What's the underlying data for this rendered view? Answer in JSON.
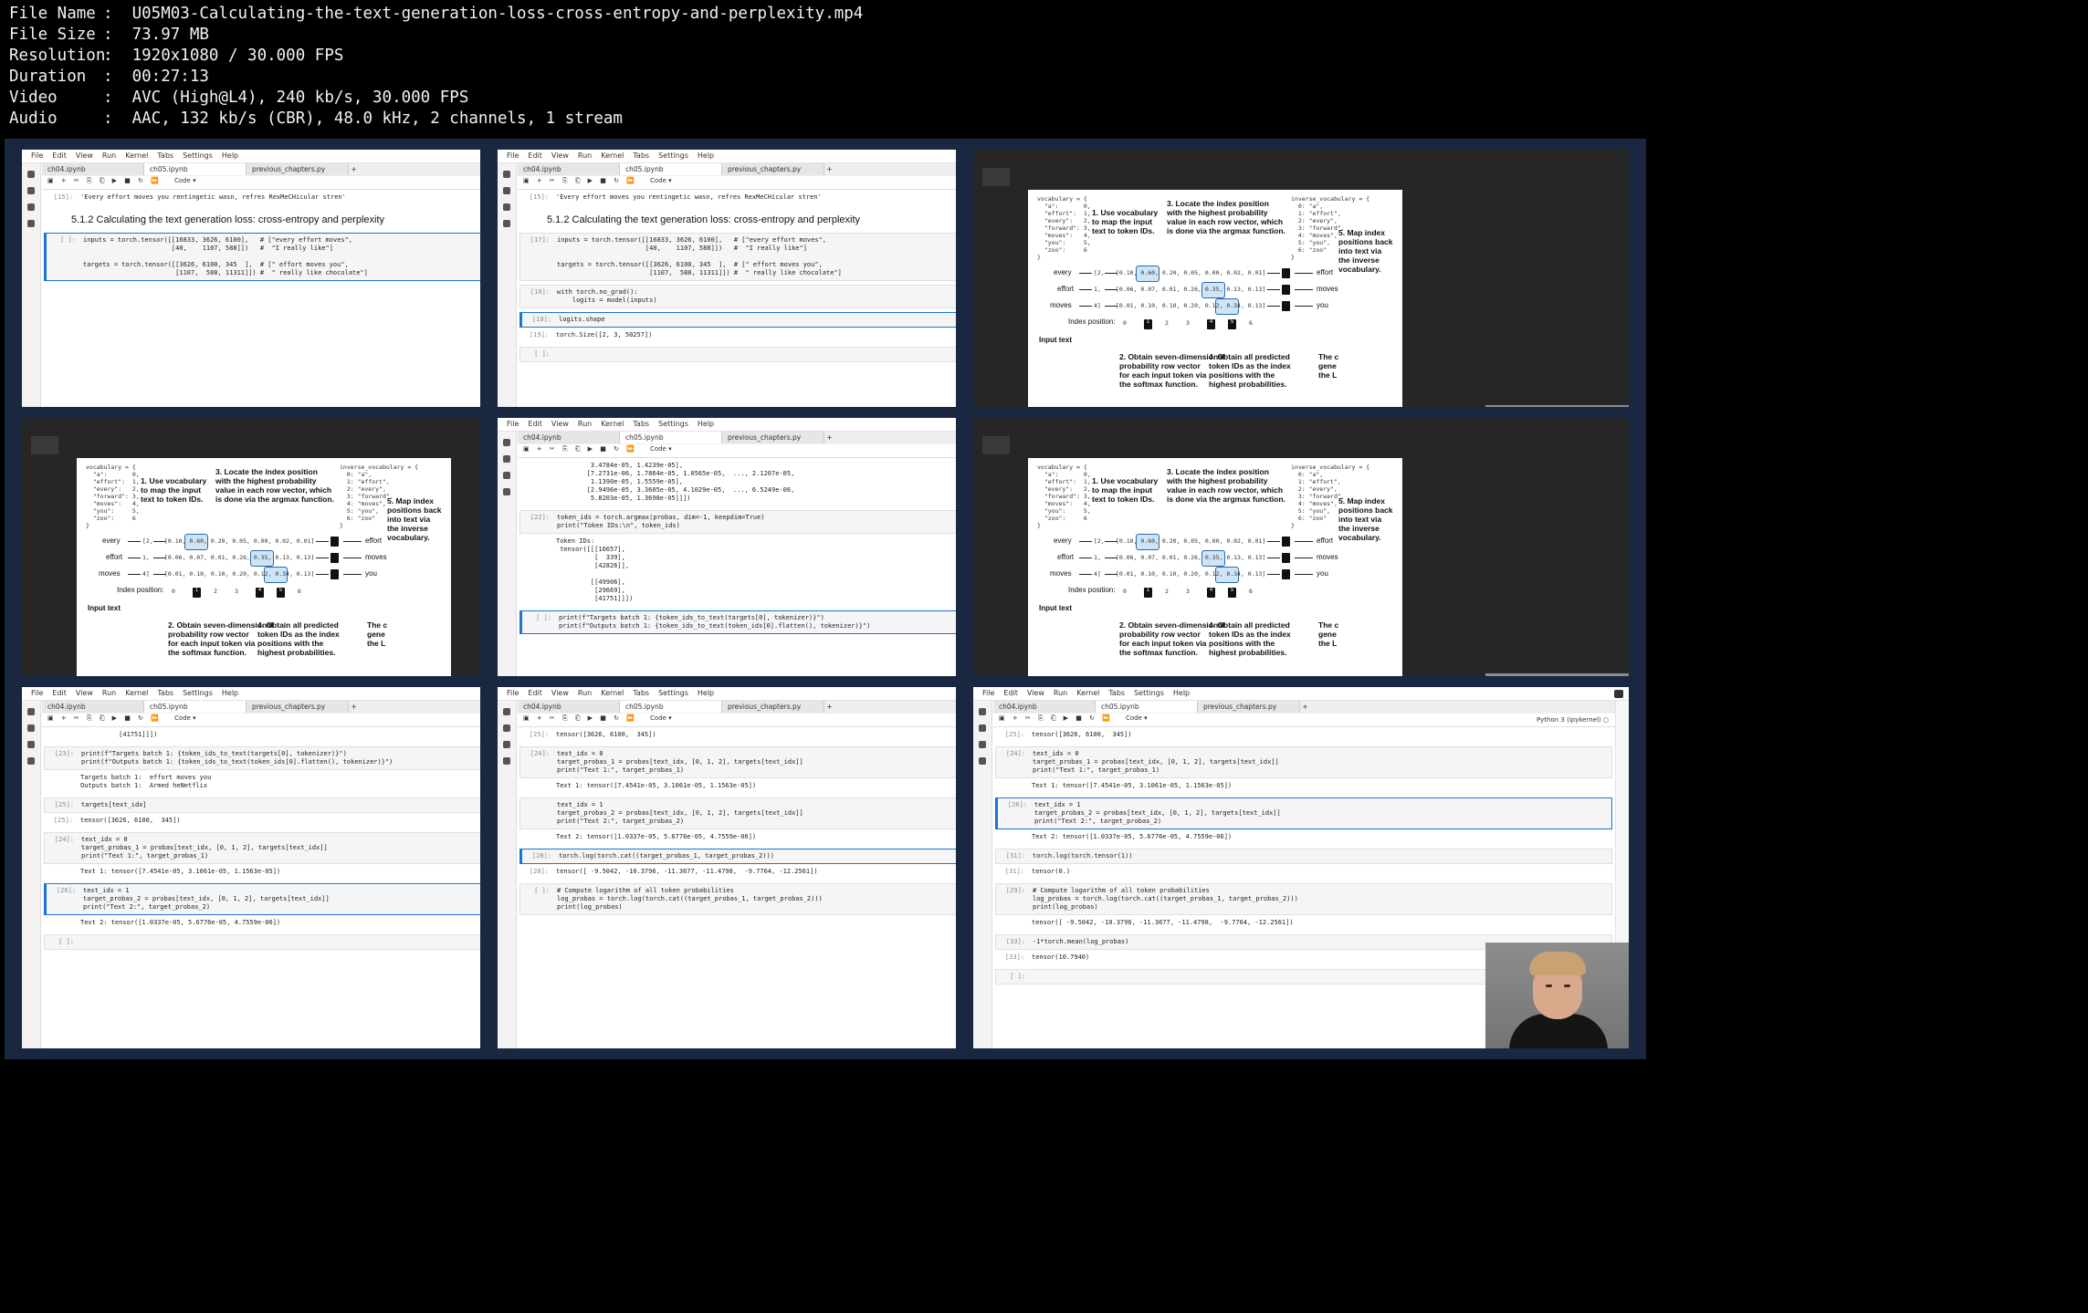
{
  "file_info": [
    {
      "key": "File Name",
      "value": "U05M03-Calculating-the-text-generation-loss-cross-entropy-and-perplexity.mp4"
    },
    {
      "key": "File Size",
      "value": "73.97 MB"
    },
    {
      "key": "Resolution",
      "value": "1920x1080 / 30.000 FPS"
    },
    {
      "key": "Duration",
      "value": "00:27:13"
    },
    {
      "key": "Video",
      "value": "AVC (High@L4), 240 kb/s, 30.000 FPS"
    },
    {
      "key": "Audio",
      "value": "AAC, 132 kb/s (CBR), 48.0 kHz, 2 channels, 1 stream"
    }
  ],
  "ui": {
    "menu": [
      "File",
      "Edit",
      "View",
      "Run",
      "Kernel",
      "Tabs",
      "Settings",
      "Help"
    ],
    "tabs": [
      "ch04.ipynb",
      "ch05.ipynb",
      "previous_chapters.py"
    ],
    "cell_type": "Code",
    "kernel": "Python 3 (ipykernel)"
  },
  "tiles": [
    {
      "type": "notebook",
      "heading": "5.1.2 Calculating the text generation loss: cross-entropy and perplexity",
      "cells": [
        {
          "prompt": "[15]:",
          "kind": "out",
          "lines": [
            "'Every effort moves you rentingetic wasn, refres RexMeCHicular stren'"
          ]
        },
        {
          "prompt": "[ ]:",
          "kind": "code",
          "active": true,
          "lines": [
            "inputs = torch.tensor([[16833, 3626, 6100],   # [\"every effort moves\",",
            "                       [40,    1107, 588]])   #  \"I really like\"]",
            "",
            "targets = torch.tensor([[3626, 6100, 345  ],  # [\" effort moves you\",",
            "                        [1107,  588, 11311]]) #  \" really like chocolate\"]"
          ]
        }
      ]
    },
    {
      "type": "notebook",
      "heading": "5.1.2 Calculating the text generation loss: cross-entropy and perplexity",
      "cells": [
        {
          "prompt": "[15]:",
          "kind": "out",
          "lines": [
            "'Every effort moves you rentingetic wasn, refres RexMeCHicular stren'"
          ]
        },
        {
          "prompt": "[17]:",
          "kind": "code",
          "lines": [
            "inputs = torch.tensor([[16833, 3626, 6100],   # [\"every effort moves\",",
            "                       [40,    1107, 588]])   #  \"I really like\"]",
            "",
            "targets = torch.tensor([[3626, 6100, 345  ],  # [\" effort moves you\",",
            "                        [1107,  588, 11311]]) #  \" really like chocolate\"]"
          ]
        },
        {
          "prompt": "[18]:",
          "kind": "code",
          "lines": [
            "with torch.no_grad():",
            "    logits = model(inputs)"
          ]
        },
        {
          "prompt": "[19]:",
          "kind": "code",
          "active": true,
          "lines": [
            "logits.shape"
          ]
        },
        {
          "prompt": "[19]:",
          "kind": "out",
          "lines": [
            "torch.Size([2, 3, 50257])"
          ]
        },
        {
          "prompt": "[ ]:",
          "kind": "code",
          "lines": [
            ""
          ]
        }
      ]
    },
    {
      "type": "diagram"
    },
    {
      "type": "diagram"
    },
    {
      "type": "notebook",
      "cells": [
        {
          "prompt": "",
          "kind": "out",
          "lines": [
            "         3.4784e-05, 1.4239e-05],",
            "        [7.2731e-06, 1.7864e-05, 1.0565e-05,  ..., 2.1207e-05,",
            "         1.1390e-05, 1.5559e-05],",
            "        [2.9496e-05, 3.3605e-05, 4.1029e-05,  ..., 6.5249e-06,",
            "         5.8203e-05, 1.3698e-05]]])"
          ]
        },
        {
          "prompt": "[22]:",
          "kind": "code",
          "lines": [
            "token_ids = torch.argmax(probas, dim=-1, keepdim=True)",
            "print(\"Token IDs:\\n\", token_ids)"
          ]
        },
        {
          "prompt": "",
          "kind": "out",
          "lines": [
            "Token IDs:",
            " tensor([[[16657],",
            "          [  339],",
            "          [42826]],",
            "",
            "         [[49906],",
            "          [29669],",
            "          [41751]]])"
          ]
        },
        {
          "prompt": "[ ]:",
          "kind": "code",
          "active": true,
          "lines": [
            "print(f\"Targets batch 1: {token_ids_to_text(targets[0], tokenizer)}\")",
            "print(f\"Outputs batch 1: {token_ids_to_text(token_ids[0].flatten(), tokenizer)}\")"
          ]
        }
      ]
    },
    {
      "type": "diagram"
    },
    {
      "type": "notebook",
      "cells": [
        {
          "prompt": "",
          "kind": "out",
          "lines": [
            "          [41751]]])"
          ]
        },
        {
          "prompt": "[23]:",
          "kind": "code",
          "lines": [
            "print(f\"Targets batch 1: {token_ids_to_text(targets[0], tokenizer)}\")",
            "print(f\"Outputs batch 1: {token_ids_to_text(token_ids[0].flatten(), tokenizer)}\")"
          ]
        },
        {
          "prompt": "",
          "kind": "out",
          "lines": [
            "Targets batch 1:  effort moves you",
            "Outputs batch 1:  Armed heNetflix"
          ]
        },
        {
          "prompt": "[25]:",
          "kind": "code",
          "lines": [
            "targets[text_idx]"
          ]
        },
        {
          "prompt": "[25]:",
          "kind": "out",
          "lines": [
            "tensor([3626, 6100,  345])"
          ]
        },
        {
          "prompt": "[24]:",
          "kind": "code",
          "lines": [
            "text_idx = 0",
            "target_probas_1 = probas[text_idx, [0, 1, 2], targets[text_idx]]",
            "print(\"Text 1:\", target_probas_1)"
          ]
        },
        {
          "prompt": "",
          "kind": "out",
          "lines": [
            "Text 1: tensor([7.4541e-05, 3.1061e-05, 1.1563e-05])"
          ]
        },
        {
          "prompt": "[26]:",
          "kind": "code",
          "active": true,
          "lines": [
            "text_idx = 1",
            "target_probas_2 = probas[text_idx, [0, 1, 2], targets[text_idx]]",
            "print(\"Text 2:\", target_probas_2)"
          ]
        },
        {
          "prompt": "",
          "kind": "out",
          "lines": [
            "Text 2: tensor([1.0337e-05, 5.6776e-05, 4.7559e-06])"
          ]
        },
        {
          "prompt": "[ ]:",
          "kind": "code",
          "lines": [
            ""
          ]
        }
      ]
    },
    {
      "type": "notebook",
      "cells": [
        {
          "prompt": "[25]:",
          "kind": "out",
          "lines": [
            "tensor([3626, 6100,  345])"
          ]
        },
        {
          "prompt": "[24]:",
          "kind": "code",
          "lines": [
            "text_idx = 0",
            "target_probas_1 = probas[text_idx, [0, 1, 2], targets[text_idx]]",
            "print(\"Text 1:\", target_probas_1)"
          ]
        },
        {
          "prompt": "",
          "kind": "out",
          "lines": [
            "Text 1: tensor([7.4541e-05, 3.1061e-05, 1.1563e-05])"
          ]
        },
        {
          "prompt": "",
          "kind": "code",
          "lines": [
            "text_idx = 1",
            "target_probas_2 = probas[text_idx, [0, 1, 2], targets[text_idx]]",
            "print(\"Text 2:\", target_probas_2)"
          ]
        },
        {
          "prompt": "",
          "kind": "out",
          "lines": [
            "Text 2: tensor([1.0337e-05, 5.6776e-05, 4.7559e-06])"
          ]
        },
        {
          "prompt": "[28]:",
          "kind": "code",
          "active": true,
          "lines": [
            "torch.log(torch.cat((target_probas_1, target_probas_2)))"
          ]
        },
        {
          "prompt": "[28]:",
          "kind": "out",
          "lines": [
            "tensor([ -9.5042, -10.3796, -11.3677, -11.4798,  -9.7764, -12.2561])"
          ]
        },
        {
          "prompt": "[ ]:",
          "kind": "code",
          "lines": [
            "# Compute logarithm of all token probabilities",
            "log_probas = torch.log(torch.cat((target_probas_1, target_probas_2)))",
            "print(log_probas)"
          ]
        }
      ]
    },
    {
      "type": "notebook",
      "cells": [
        {
          "prompt": "[25]:",
          "kind": "out",
          "lines": [
            "tensor([3626, 6100,  345])"
          ]
        },
        {
          "prompt": "[24]:",
          "kind": "code",
          "lines": [
            "text_idx = 0",
            "target_probas_1 = probas[text_idx, [0, 1, 2], targets[text_idx]]",
            "print(\"Text 1:\", target_probas_1)"
          ]
        },
        {
          "prompt": "",
          "kind": "out",
          "lines": [
            "Text 1: tensor([7.4541e-05, 3.1061e-05, 1.1563e-05])"
          ]
        },
        {
          "prompt": "[26]:",
          "kind": "code",
          "active": true,
          "lines": [
            "text_idx = 1",
            "target_probas_2 = probas[text_idx, [0, 1, 2], targets[text_idx]]",
            "print(\"Text 2:\", target_probas_2)"
          ]
        },
        {
          "prompt": "",
          "kind": "out",
          "lines": [
            "Text 2: tensor([1.0337e-05, 5.6776e-05, 4.7559e-06])"
          ]
        },
        {
          "prompt": "[31]:",
          "kind": "code",
          "lines": [
            "torch.log(torch.tensor(1))"
          ]
        },
        {
          "prompt": "[31]:",
          "kind": "out",
          "lines": [
            "tensor(0.)"
          ]
        },
        {
          "prompt": "[29]:",
          "kind": "code",
          "lines": [
            "# Compute logarithm of all token probabilities",
            "log_probas = torch.log(torch.cat((target_probas_1, target_probas_2)))",
            "print(log_probas)"
          ]
        },
        {
          "prompt": "",
          "kind": "out",
          "lines": [
            "tensor([ -9.5042, -10.3796, -11.3677, -11.4798,  -9.7764, -12.2561])"
          ]
        },
        {
          "prompt": "[33]:",
          "kind": "code",
          "lines": [
            "-1*torch.mean(log_probas)"
          ]
        },
        {
          "prompt": "[33]:",
          "kind": "out",
          "lines": [
            "tensor(10.7940)"
          ]
        },
        {
          "prompt": "[ ]:",
          "kind": "code",
          "lines": [
            ""
          ]
        }
      ]
    }
  ],
  "diagram": {
    "vocab_left": "vocabulary = {\n  \"a\":       0,\n  \"effort\":  1,\n  \"every\":   2,\n  \"forward\": 3,\n  \"moves\":   4,\n  \"you\":     5,\n  \"zoo\":     6\n}",
    "vocab_right": "inverse_vocabulary = {\n  0: \"a\",\n  1: \"effort\",\n  2: \"every\",\n  3: \"forward\",\n  4: \"moves\",\n  5: \"you\",\n  6: \"zoo\"\n}",
    "note1": "1. Use vocabulary\nto map the input\ntext to token IDs.",
    "note3": "3. Locate the index position\nwith the highest probability\nvalue in each row vector, which\nis done via the argmax function.",
    "note5": "5. Map index\npositions back\ninto text via\nthe inverse\nvocabulary.",
    "note2": "2. Obtain seven-dimensional\nprobability row vector\nfor each input token via\nthe softmax function.",
    "note4": "4. Obtain all predicted\ntoken IDs as the index\npositions with the\nhighest probabilities.",
    "note6": "The c\ngene\nthe L",
    "rows": [
      {
        "word": "every",
        "id": "[2,",
        "vec": "[0.10, 0.60, 0.20, 0.05, 0.00, 0.02, 0.01]",
        "out_id": "2",
        "out_word": "effort"
      },
      {
        "word": "effort",
        "id": "1,",
        "vec": "[0.06, 0.07, 0.01, 0.26, 0.35, 0.13, 0.13]",
        "out_id": "4",
        "out_word": "moves"
      },
      {
        "word": "moves",
        "id": "4]",
        "vec": "[0.01, 0.10, 0.10, 0.20, 0.12, 0.34, 0.13]",
        "out_id": "5",
        "out_word": "you"
      }
    ],
    "index_label": "Index position:",
    "indices": [
      "0",
      "1",
      "2",
      "3",
      "4",
      "5",
      "6"
    ],
    "input_label": "Input text",
    "hl_values": [
      "0.60",
      "0.35",
      "0.34"
    ]
  }
}
